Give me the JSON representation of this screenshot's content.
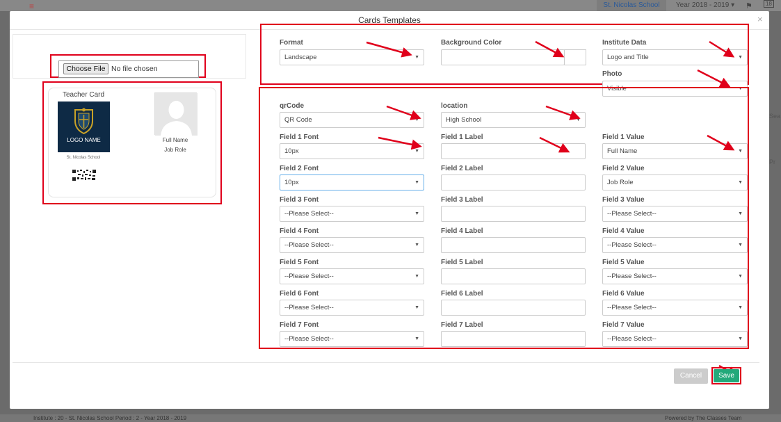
{
  "backdrop": {
    "school": "St. Nicolas School",
    "year": "Year 2018 - 2019",
    "notif_count": "18",
    "side_text_1": "Sea",
    "side_text_2": "Pr",
    "footer_left": "Institute : 20 - St. Nicolas School Period : 2 - Year 2018 - 2019",
    "footer_right": "Powered by The Classes Team"
  },
  "modal": {
    "title": "Cards Templates",
    "close": "×"
  },
  "upload": {
    "choose_label": "Choose File",
    "status": "No file chosen"
  },
  "card": {
    "title": "Teacher Card",
    "logo_text": "LOGO NAME",
    "school_name": "St. Nicolas School",
    "full_name": "Full Name",
    "job_role": "Job Role"
  },
  "form": {
    "format": {
      "label": "Format",
      "value": "Landscape"
    },
    "background_color": {
      "label": "Background Color",
      "value": ""
    },
    "institute_data": {
      "label": "Institute Data",
      "value": "Logo and Title"
    },
    "photo": {
      "label": "Photo",
      "value": "Visible"
    },
    "qrcode": {
      "label": "qrCode",
      "value": "QR Code"
    },
    "location": {
      "label": "location",
      "value": "High School"
    },
    "fields": [
      {
        "font_label": "Field 1 Font",
        "font_value": "10px",
        "label_label": "Field 1 Label",
        "label_value": "",
        "value_label": "Field 1 Value",
        "value_value": "Full Name"
      },
      {
        "font_label": "Field 2 Font",
        "font_value": "10px",
        "label_label": "Field 2 Label",
        "label_value": "",
        "value_label": "Field 2 Value",
        "value_value": "Job Role"
      },
      {
        "font_label": "Field 3 Font",
        "font_value": "--Please Select--",
        "label_label": "Field 3 Label",
        "label_value": "",
        "value_label": "Field 3 Value",
        "value_value": "--Please Select--"
      },
      {
        "font_label": "Field 4 Font",
        "font_value": "--Please Select--",
        "label_label": "Field 4 Label",
        "label_value": "",
        "value_label": "Field 4 Value",
        "value_value": "--Please Select--"
      },
      {
        "font_label": "Field 5 Font",
        "font_value": "--Please Select--",
        "label_label": "Field 5 Label",
        "label_value": "",
        "value_label": "Field 5 Value",
        "value_value": "--Please Select--"
      },
      {
        "font_label": "Field 6 Font",
        "font_value": "--Please Select--",
        "label_label": "Field 6 Label",
        "label_value": "",
        "value_label": "Field 6 Value",
        "value_value": "--Please Select--"
      },
      {
        "font_label": "Field 7 Font",
        "font_value": "--Please Select--",
        "label_label": "Field 7 Label",
        "label_value": "",
        "value_label": "Field 7 Value",
        "value_value": "--Please Select--"
      }
    ]
  },
  "footer": {
    "cancel_label": "Cancel",
    "save_label": "Save"
  },
  "colors": {
    "highlight": "#e0001b",
    "save": "#22a97a",
    "cancel": "#cccccc",
    "logo_bg": "#0e2a45"
  },
  "icons": {
    "caret": "▼",
    "menu": "≡",
    "flag": "⚑"
  }
}
